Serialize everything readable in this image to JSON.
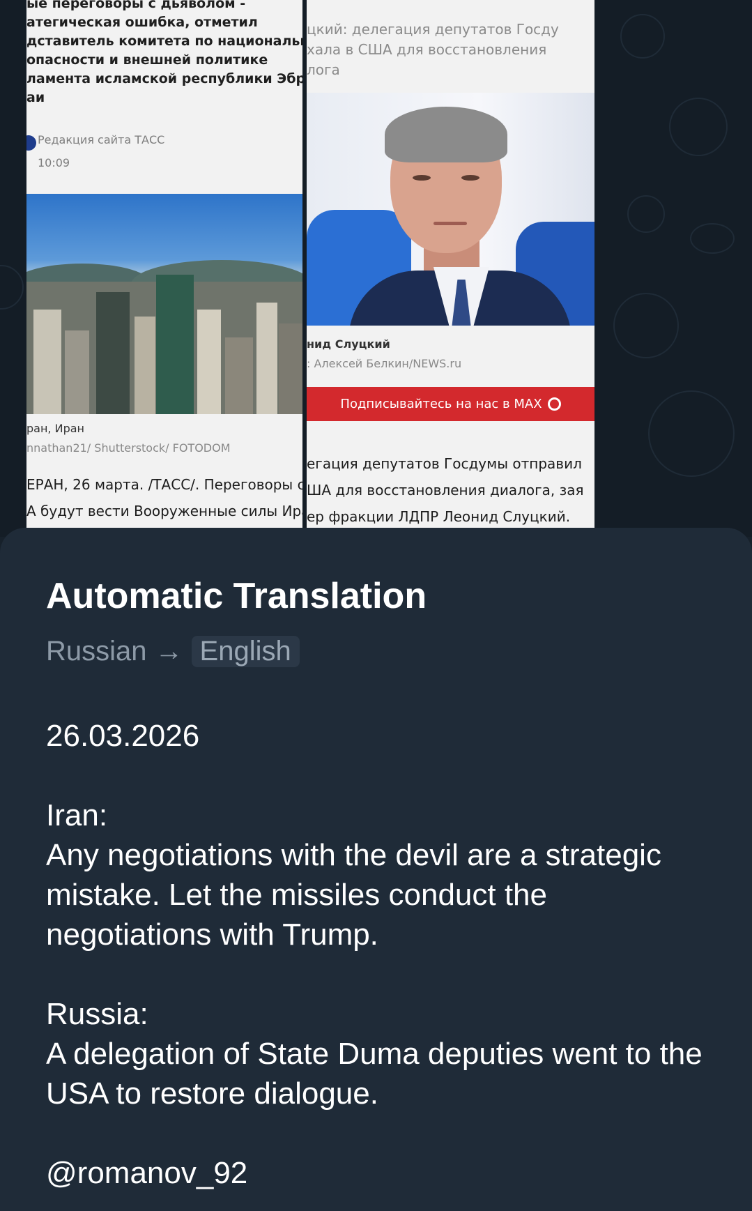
{
  "left_article": {
    "headline_lines": [
      "ые переговоры с дьяволом -",
      "атегическая ошибка, отметил",
      "дставитель комитета по национально",
      "опасности и внешней политике",
      "ламента исламской республики Эбра",
      "аи"
    ],
    "author": "Редакция сайта ТАСС",
    "time": "10:09",
    "photo_caption": "ран, Иран",
    "photo_credit": "nnathan21/ Shutterstock/ FOTODOM",
    "body_lines": [
      "ЕРАН, 26 марта. /ТАСС/. Переговоры с",
      "А будут вести Вооруженные силы Ира"
    ]
  },
  "right_article": {
    "subhead_lines": [
      "цкий: делегация депутатов Госду",
      "хала в США для восстановления",
      "лога"
    ],
    "photo_caption": "нид Слуцкий",
    "photo_credit": ": Алексей Белкин/NEWS.ru",
    "subscribe_label": "Подписывайтесь на нас в MAX",
    "body_lines": [
      "егация депутатов Госдумы отправил",
      "ША для восстановления диалога, зая",
      "ер фракции ЛДПР Леонид Слуцкий."
    ]
  },
  "translation": {
    "title": "Automatic Translation",
    "source_lang": "Russian",
    "arrow": "→",
    "target_lang": "English",
    "text": "26.03.2026\n\nIran:\nAny negotiations with the devil are a strategic mistake. Let the missiles conduct the negotiations with Trump.\n\nRussia:\nA delegation of State Duma deputies went to the USA to restore dialogue.\n\n@romanov_92"
  },
  "colors": {
    "sheet_bg": "#1f2b38",
    "wallpaper_bg": "#141d26",
    "accent_red": "#d3292d"
  }
}
